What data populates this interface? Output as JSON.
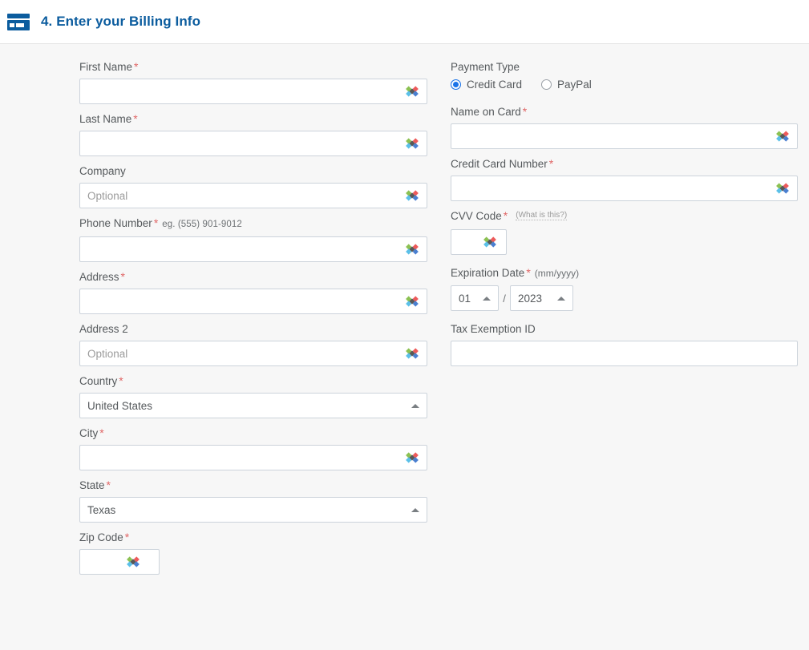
{
  "header": {
    "icon": "credit-card-icon",
    "title": "4. Enter your Billing Info",
    "title_color": "#0b5c9e"
  },
  "colors": {
    "accent_blue": "#0b5c9e",
    "radio_selected": "#1a73e8",
    "required_asterisk": "#e06666",
    "label_text": "#55595c",
    "input_border": "#ccd3db",
    "page_background": "#f7f7f7"
  },
  "left_column": {
    "first_name": {
      "label": "First Name",
      "required": "*",
      "value": "",
      "placeholder": "",
      "autofill_icon": "autofill-diamonds-icon"
    },
    "last_name": {
      "label": "Last Name",
      "required": "*",
      "value": "",
      "placeholder": "",
      "autofill_icon": "autofill-diamonds-icon"
    },
    "company": {
      "label": "Company",
      "required": "",
      "value": "",
      "placeholder": "Optional",
      "autofill_icon": "autofill-diamonds-icon"
    },
    "phone_number": {
      "label": "Phone Number",
      "required": "*",
      "hint": "eg. (555) 901-9012",
      "value": "",
      "placeholder": "",
      "autofill_icon": "autofill-diamonds-icon"
    },
    "address": {
      "label": "Address",
      "required": "*",
      "value": "",
      "placeholder": "",
      "autofill_icon": "autofill-diamonds-icon"
    },
    "address_2": {
      "label": "Address 2",
      "required": "",
      "value": "",
      "placeholder": "Optional",
      "autofill_icon": "autofill-diamonds-icon"
    },
    "country": {
      "label": "Country",
      "required": "*",
      "value": "United States",
      "caret_icon": "chevron-up-icon"
    },
    "city": {
      "label": "City",
      "required": "*",
      "value": "",
      "placeholder": "",
      "autofill_icon": "autofill-diamonds-icon"
    },
    "state": {
      "label": "State",
      "required": "*",
      "value": "Texas",
      "caret_icon": "chevron-up-icon"
    },
    "zip_code": {
      "label": "Zip Code",
      "required": "*",
      "value": "",
      "placeholder": "",
      "autofill_icon": "autofill-diamonds-icon"
    }
  },
  "right_column": {
    "payment_type": {
      "label": "Payment Type",
      "options": [
        {
          "label": "Credit Card",
          "selected": true
        },
        {
          "label": "PayPal",
          "selected": false
        }
      ]
    },
    "name_on_card": {
      "label": "Name on Card",
      "required": "*",
      "value": "",
      "placeholder": "",
      "autofill_icon": "autofill-diamonds-icon"
    },
    "credit_card_number": {
      "label": "Credit Card Number",
      "required": "*",
      "value": "",
      "placeholder": "",
      "autofill_icon": "autofill-diamonds-icon"
    },
    "cvv_code": {
      "label": "CVV Code",
      "required": "*",
      "help_link": "(What is this?)",
      "value": "",
      "placeholder": "",
      "autofill_icon": "autofill-diamonds-icon"
    },
    "expiration_date": {
      "label": "Expiration Date",
      "required": "*",
      "format_hint": "(mm/yyyy)",
      "month": "01",
      "separator": "/",
      "year": "2023",
      "caret_icon": "chevron-up-icon"
    },
    "tax_exemption_id": {
      "label": "Tax Exemption ID",
      "required": "",
      "value": "",
      "placeholder": ""
    }
  }
}
